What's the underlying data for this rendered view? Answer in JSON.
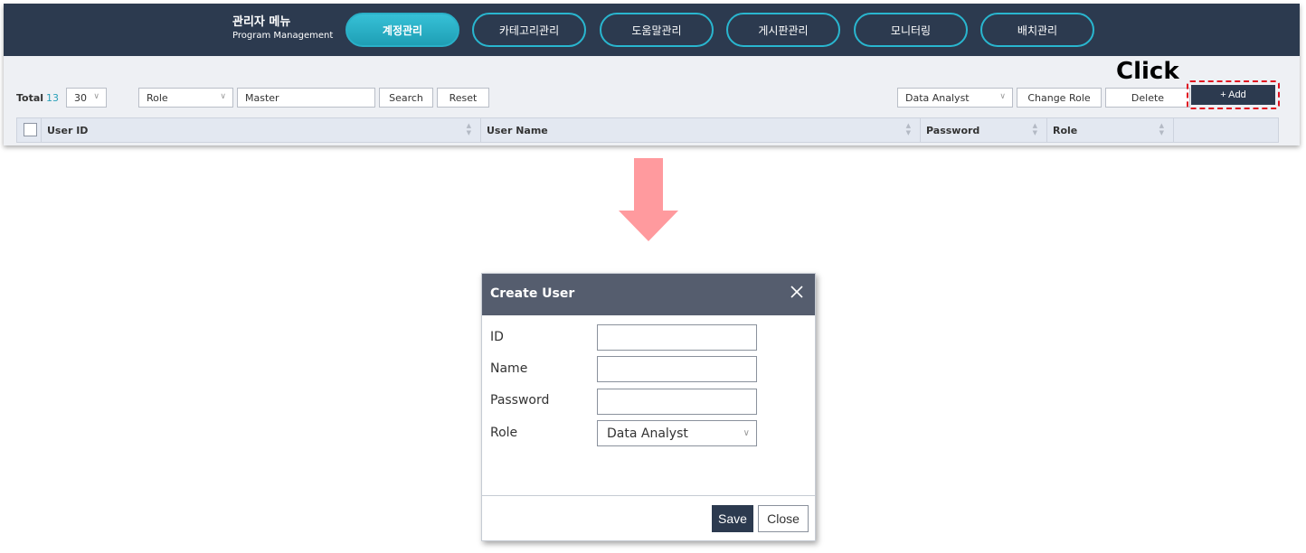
{
  "header": {
    "title": "관리자 메뉴",
    "subtitle": "Program Management",
    "tabs": [
      {
        "label": "계정관리",
        "active": true
      },
      {
        "label": "카테고리관리"
      },
      {
        "label": "도움말관리"
      },
      {
        "label": "게시판관리"
      },
      {
        "label": "모니터링"
      },
      {
        "label": "배치관리"
      }
    ]
  },
  "toolbar": {
    "total_label": "Total",
    "total_count": "13",
    "page_size": "30",
    "filter_select": "Role",
    "filter_value": "Master",
    "search_label": "Search",
    "reset_label": "Reset",
    "role_select": "Data Analyst",
    "change_role_label": "Change Role",
    "delete_label": "Delete",
    "add_label": "+ Add"
  },
  "annotation": {
    "click_label": "Click"
  },
  "grid": {
    "columns": [
      "User ID",
      "User Name",
      "Password",
      "Role"
    ]
  },
  "dialog": {
    "title": "Create User",
    "fields": [
      {
        "label": "ID",
        "value": ""
      },
      {
        "label": "Name",
        "value": ""
      },
      {
        "label": "Password",
        "value": ""
      },
      {
        "label": "Role",
        "value": "Data Analyst"
      }
    ],
    "save_label": "Save",
    "close_label": "Close"
  },
  "colors": {
    "header_bg": "#2c3a4f",
    "tab_accent": "#29b6cf",
    "highlight": "#e01020",
    "arrow": "#ff9a9e",
    "dialog_header": "#555d6e"
  }
}
